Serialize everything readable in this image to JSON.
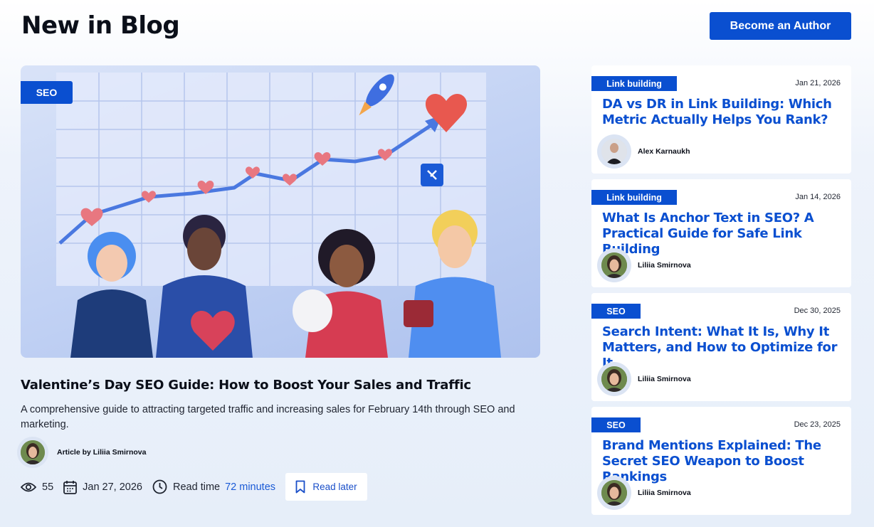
{
  "header": {
    "title": "New in Blog",
    "become_author": "Become an Author"
  },
  "featured": {
    "tag": "SEO",
    "title": "Valentine’s Day SEO Guide: How to Boost Your Sales and Traffic",
    "description": "A comprehensive guide to attracting targeted traffic and increasing sales for February 14th through SEO and marketing.",
    "author_line": "Article by Liliia Smirnova",
    "views": "55",
    "date": "Jan 27, 2026",
    "read_time_label": "Read time",
    "read_time_value": "72 minutes",
    "read_later": "Read later"
  },
  "cards": [
    {
      "tag": "Link building",
      "date": "Jan 21, 2026",
      "title": "DA vs DR in Link Building: Which Metric Actually Helps You Rank?",
      "author": "Alex Karnaukh"
    },
    {
      "tag": "Link building",
      "date": "Jan 14, 2026",
      "title": "What Is Anchor Text in SEO? A Practical Guide for Safe Link Building",
      "author": "Liliia Smirnova"
    },
    {
      "tag": "SEO",
      "date": "Dec 30, 2025",
      "title": "Search Intent: What It Is, Why It Matters, and How to Optimize for It",
      "author": "Liliia Smirnova"
    },
    {
      "tag": "SEO",
      "date": "Dec 23, 2025",
      "title": "Brand Mentions Explained: The Secret SEO Weapon to Boost Rankings",
      "author": "Liliia Smirnova"
    }
  ],
  "colors": {
    "accent": "#0a4fd0",
    "link": "#1a5ad6",
    "background": "#e6eef9"
  },
  "icons": [
    "eye-icon",
    "calendar-icon",
    "clock-icon",
    "bookmark-icon"
  ]
}
